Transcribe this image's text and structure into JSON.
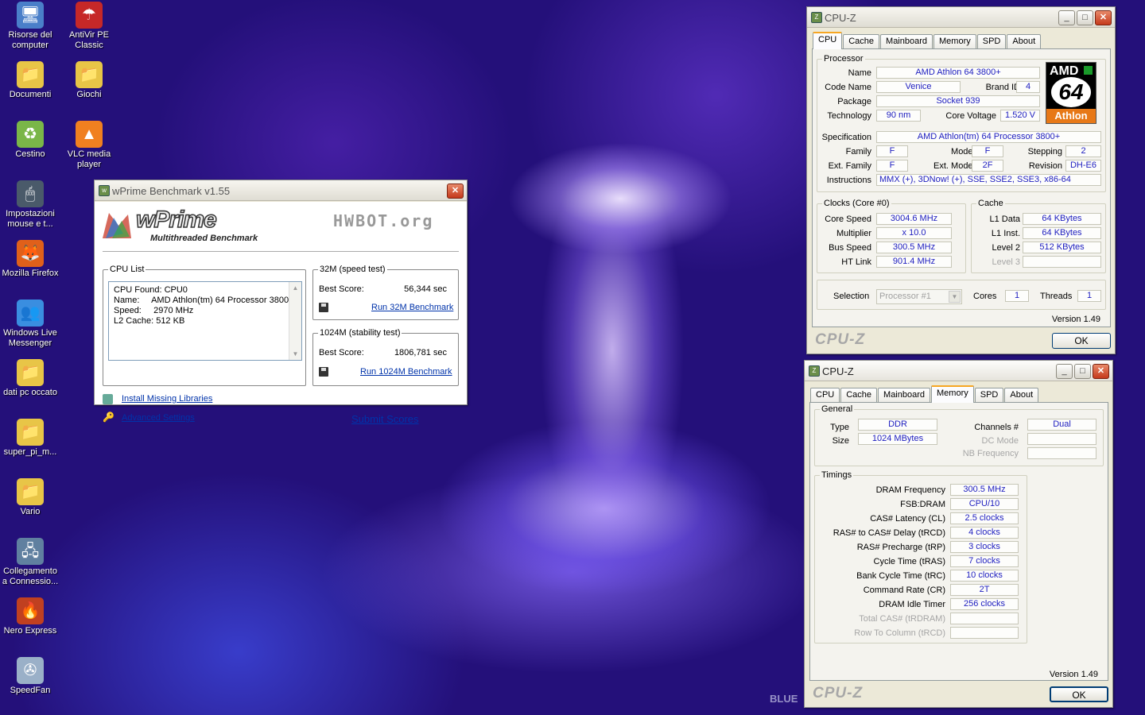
{
  "desktop": {
    "icons": [
      {
        "label": "Risorse del computer",
        "glyph": "🖥"
      },
      {
        "label": "AntiVir PE Classic",
        "glyph": "☂"
      },
      {
        "label": "Documenti",
        "glyph": "📁"
      },
      {
        "label": "Giochi",
        "glyph": "📁"
      },
      {
        "label": "Cestino",
        "glyph": "♻"
      },
      {
        "label": "VLC media player",
        "glyph": "▲"
      },
      {
        "label": "Impostazioni mouse e t...",
        "glyph": "🖱"
      },
      {
        "label": "Mozilla Firefox",
        "glyph": "🦊"
      },
      {
        "label": "Windows Live Messenger",
        "glyph": "👥"
      },
      {
        "label": "dati pc occato",
        "glyph": "📁"
      },
      {
        "label": "super_pi_m...",
        "glyph": "📁"
      },
      {
        "label": "Vario",
        "glyph": "📁"
      },
      {
        "label": "Collegamento a Connessio...",
        "glyph": "🖧"
      },
      {
        "label": "Nero Express",
        "glyph": "🔥"
      },
      {
        "label": "SpeedFan",
        "glyph": "✇"
      }
    ],
    "wallpaper_text": "BLUE"
  },
  "wprime": {
    "title": "wPrime Benchmark v1.55",
    "logo": "wPrime",
    "logo_sub": "Multithreaded Benchmark",
    "hwbot": "HWBOT.org",
    "cpu_list_label": "CPU List",
    "cpu_lines": [
      "CPU Found: CPU0",
      "Name:     AMD Athlon(tm) 64 Processor 3800+",
      "Speed:     2970 MHz",
      "L2 Cache: 512 KB"
    ],
    "test32_label": "32M (speed test)",
    "best_score_label": "Best Score:",
    "test32_score": "56,344 sec",
    "run32": "Run 32M Benchmark",
    "test1024_label": "1024M (stability test)",
    "test1024_score": "1806,781 sec",
    "run1024": "Run 1024M Benchmark",
    "install": "Install Missing Libraries",
    "advanced": "Advanced Settings",
    "submit": "Submit Scores"
  },
  "cpuz1": {
    "title": "CPU-Z",
    "tabs": [
      "CPU",
      "Cache",
      "Mainboard",
      "Memory",
      "SPD",
      "About"
    ],
    "processor_label": "Processor",
    "name_label": "Name",
    "name": "AMD Athlon 64 3800+",
    "codename_label": "Code Name",
    "codename": "Venice",
    "brandid_label": "Brand ID",
    "brandid": "4",
    "package_label": "Package",
    "package": "Socket 939",
    "tech_label": "Technology",
    "tech": "90 nm",
    "voltage_label": "Core Voltage",
    "voltage": "1.520 V",
    "spec_label": "Specification",
    "spec": "AMD Athlon(tm) 64 Processor 3800+",
    "family_label": "Family",
    "family": "F",
    "model_label": "Model",
    "model": "F",
    "stepping_label": "Stepping",
    "stepping": "2",
    "extfamily_label": "Ext. Family",
    "extfamily": "F",
    "extmodel_label": "Ext. Model",
    "extmodel": "2F",
    "revision_label": "Revision",
    "revision": "DH-E6",
    "instr_label": "Instructions",
    "instr": "MMX (+), 3DNow! (+), SSE, SSE2, SSE3, x86-64",
    "logo_top": "AMD",
    "logo_num": "64",
    "logo_bottom": "Athlon",
    "clocks_label": "Clocks (Core #0)",
    "corespeed_label": "Core Speed",
    "corespeed": "3004.6 MHz",
    "mult_label": "Multiplier",
    "mult": "x 10.0",
    "bus_label": "Bus Speed",
    "bus": "300.5 MHz",
    "ht_label": "HT Link",
    "ht": "901.4 MHz",
    "cache_label": "Cache",
    "l1d_label": "L1 Data",
    "l1d": "64 KBytes",
    "l1i_label": "L1 Inst.",
    "l1i": "64 KBytes",
    "l2_label": "Level 2",
    "l2": "512 KBytes",
    "l3_label": "Level 3",
    "l3": "",
    "selection_label": "Selection",
    "selection": "Processor #1",
    "cores_label": "Cores",
    "cores": "1",
    "threads_label": "Threads",
    "threads": "1",
    "version": "Version 1.49",
    "brand": "CPU-Z",
    "ok": "OK"
  },
  "cpuz2": {
    "title": "CPU-Z",
    "tabs": [
      "CPU",
      "Cache",
      "Mainboard",
      "Memory",
      "SPD",
      "About"
    ],
    "general_label": "General",
    "type_label": "Type",
    "type": "DDR",
    "size_label": "Size",
    "size": "1024 MBytes",
    "channels_label": "Channels #",
    "channels": "Dual",
    "dcmode_label": "DC Mode",
    "dcmode": "",
    "nbfreq_label": "NB Frequency",
    "nbfreq": "",
    "timings_label": "Timings",
    "timings": [
      {
        "label": "DRAM Frequency",
        "value": "300.5 MHz",
        "dim": false
      },
      {
        "label": "FSB:DRAM",
        "value": "CPU/10",
        "dim": false
      },
      {
        "label": "CAS# Latency (CL)",
        "value": "2.5 clocks",
        "dim": false
      },
      {
        "label": "RAS# to CAS# Delay (tRCD)",
        "value": "4 clocks",
        "dim": false
      },
      {
        "label": "RAS# Precharge (tRP)",
        "value": "3 clocks",
        "dim": false
      },
      {
        "label": "Cycle Time (tRAS)",
        "value": "7 clocks",
        "dim": false
      },
      {
        "label": "Bank Cycle Time (tRC)",
        "value": "10 clocks",
        "dim": false
      },
      {
        "label": "Command Rate (CR)",
        "value": "2T",
        "dim": false
      },
      {
        "label": "DRAM Idle Timer",
        "value": "256 clocks",
        "dim": false
      },
      {
        "label": "Total CAS# (tRDRAM)",
        "value": "",
        "dim": true
      },
      {
        "label": "Row To Column (tRCD)",
        "value": "",
        "dim": true
      }
    ],
    "version": "Version 1.49",
    "brand": "CPU-Z",
    "ok": "OK"
  }
}
